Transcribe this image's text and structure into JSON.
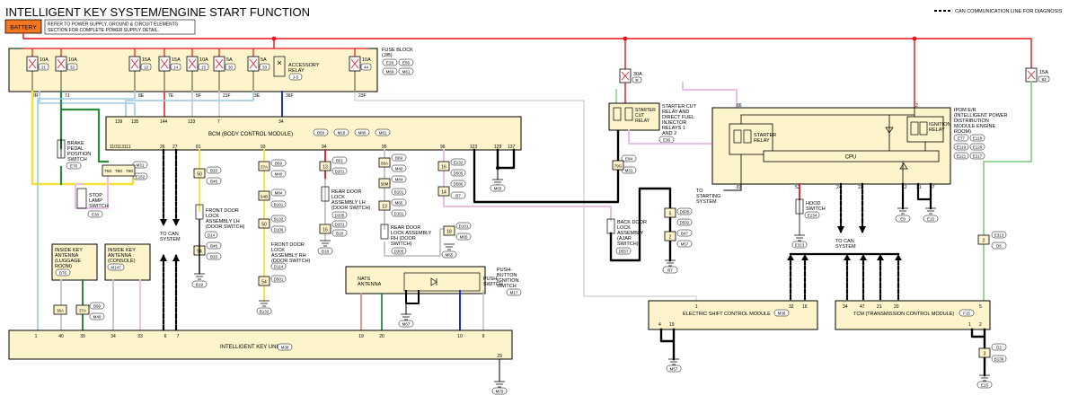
{
  "title": "INTELLIGENT KEY SYSTEM/ENGINE START FUNCTION",
  "battery": "BATTERY",
  "refer_note": [
    "REFER TO POWER SUPPLY, GROUND & CIRCUIT ELEMENTS",
    "SECTION FOR COMPLETE POWER SUPPLY DETAIL."
  ],
  "legend": ": CAN COMMUNICATION LINE FOR DIAGNOSIS",
  "fuse_block": {
    "label": [
      "FUSE BLOCK",
      "(J/B)"
    ],
    "connectors": [
      "E28",
      "E55",
      "M69",
      "M61"
    ],
    "fuses": [
      {
        "amp": "10A",
        "num": "21"
      },
      {
        "amp": "10A",
        "num": "32"
      },
      {
        "amp": "15A",
        "num": "12"
      },
      {
        "amp": "15A",
        "num": "14"
      },
      {
        "amp": "10A",
        "num": "15"
      },
      {
        "amp": "5A",
        "num": "30"
      },
      {
        "amp": "5A",
        "num": "33"
      },
      {
        "amp": "10A",
        "num": "44"
      }
    ],
    "relay": [
      "ACCESSORY",
      "RELAY"
    ],
    "relay_conn": "J-5",
    "pins": [
      "2R",
      "7J",
      "8E",
      "7E",
      "5F",
      "21F",
      "3E",
      "36F",
      "23F"
    ]
  },
  "bcm": {
    "label": "BCM (BODY CONTROL MODULE)",
    "connectors": [
      "B59",
      "M18",
      "M80",
      "M81"
    ],
    "top_pins": [
      "139",
      "135",
      "144",
      "133",
      "7",
      "34"
    ],
    "bottom_pins": [
      "110",
      "113",
      "111",
      "26",
      "27",
      "81",
      "93",
      "94",
      "95",
      "96",
      "123",
      "129",
      "137"
    ],
    "side_conn": [
      "M31",
      "E152"
    ]
  },
  "fuse_r": {
    "amp": "30A",
    "num": "R"
  },
  "fuse_93": {
    "amp": "15A",
    "num": "93"
  },
  "starter_cut": {
    "label": [
      "STARTER CUT",
      "RELAY AND",
      "DIRECT FUEL",
      "INJECTOR",
      "RELAYS 1",
      "AND 2"
    ],
    "relay": [
      "STARTER",
      "CUT",
      "RELAY"
    ],
    "conn": "E36"
  },
  "ipdm": {
    "label": [
      "IPDM E/R",
      "(INTELLIGENT POWER",
      "DISTRIBUTION",
      "MODULE ENGINE",
      "ROOM)"
    ],
    "connectors": [
      "E77",
      "E118",
      "E119",
      "E120",
      "E121",
      "E217"
    ],
    "starter_relay": [
      "STARTER",
      "RELAY"
    ],
    "ignition_relay": [
      "IGNITION",
      "RELAY"
    ],
    "cpu": "CPU",
    "pins": [
      "86",
      "2",
      "83",
      "52",
      "24",
      "22",
      "12",
      "31",
      "47"
    ]
  },
  "brake_switch": {
    "label": [
      "BRAKE",
      "PEDAL",
      "POSITION",
      "SWITCH"
    ],
    "conn": "E76"
  },
  "stop_lamp": {
    "label": [
      "STOP",
      "LAMP",
      "SWITCH"
    ],
    "conn": "E38"
  },
  "front_lh": {
    "label": [
      "FRONT DOOR",
      "LOCK",
      "ASSEMBLY LH",
      "(DOOR SWITCH)"
    ],
    "conn": "D14"
  },
  "front_rh": {
    "label": [
      "FRONT DOOR",
      "LOCK",
      "ASSEMBLY RH",
      "(DOOR SWITCH)"
    ],
    "conn": "D114"
  },
  "rear_lh": {
    "label": [
      "REAR DOOR",
      "LOCK",
      "ASSEMBLY LH",
      "(DOOR SWITCH)"
    ],
    "conn": "D205"
  },
  "rear_rh": {
    "label": [
      "REAR DOOR",
      "LOCK ASSEMBLY",
      "RH (DOOR",
      "SWITCH)"
    ],
    "conn": "D305"
  },
  "back_door": {
    "label": [
      "BACK DOOR",
      "LOCK",
      "ASSEMBLY",
      "(AJAR",
      "SWITCH)"
    ],
    "conn": "D557"
  },
  "to_can": [
    "TO CAN",
    "SYSTEM"
  ],
  "to_starting": [
    "TO",
    "STARTING",
    "SYSTEM"
  ],
  "hood": {
    "label": [
      "HOOD",
      "SWITCH"
    ],
    "conn": "E234"
  },
  "antenna_luggage": {
    "label": [
      "INSIDE KEY",
      "ANTENNA",
      "(LUGGAGE",
      "ROOM)"
    ],
    "conn": "B76"
  },
  "antenna_console": {
    "label": [
      "INSIDE KEY",
      "ANTENNA",
      "(CONSOLE)"
    ],
    "conn": "M147"
  },
  "nats": [
    "NATS",
    "ANTENNA"
  ],
  "push_button": {
    "label": [
      "PUSH-",
      "BUTTON",
      "IGNITION",
      "SWITCH"
    ],
    "conn": "M17",
    "inner": [
      "PUSH",
      "SWITCH"
    ]
  },
  "key_unit": {
    "label": "INTELLIGENT KEY UNIT",
    "conn": "M38",
    "pins": [
      "1",
      "40",
      "39",
      "34",
      "33",
      "6",
      "7",
      "19",
      "20",
      "10",
      "9",
      "29"
    ]
  },
  "shift_module": {
    "label": "ELECTRIC SHIFT CONTROL MODULE",
    "conn": "M36",
    "pins": [
      "1",
      "32",
      "16",
      "4",
      "19"
    ]
  },
  "tcm": {
    "label": "TCM (TRANSMISSION CONTROL MODULE)",
    "conn": "F15",
    "pins": [
      "34",
      "47",
      "21",
      "20",
      "5",
      "1",
      "2"
    ]
  },
  "connectors_misc": [
    "B26",
    "B19",
    "B69",
    "M40",
    "M84",
    "B101",
    "B132",
    "B51",
    "D201",
    "D101",
    "D106",
    "B18",
    "B16",
    "B102",
    "D561",
    "D501",
    "D505",
    "D502",
    "D586",
    "B47",
    "B7",
    "B46",
    "M65",
    "M57",
    "M79",
    "E132",
    "E31",
    "E13",
    "E9",
    "E15",
    "E84",
    "F93",
    "F33",
    "E19",
    "E313",
    "D5",
    "D2",
    "B136",
    "M31",
    "B7"
  ],
  "ground_labels": [
    "B19",
    "B132",
    "B18",
    "B136",
    "M65",
    "B7",
    "E313",
    "E9",
    "E15",
    "M57",
    "M67",
    "M79",
    "E15"
  ],
  "misc_numbers": [
    "7J",
    "36A",
    "37A",
    "77G",
    "75G",
    "78G",
    "79G",
    "5",
    "6",
    "4",
    "2",
    "3",
    "8",
    "7"
  ]
}
